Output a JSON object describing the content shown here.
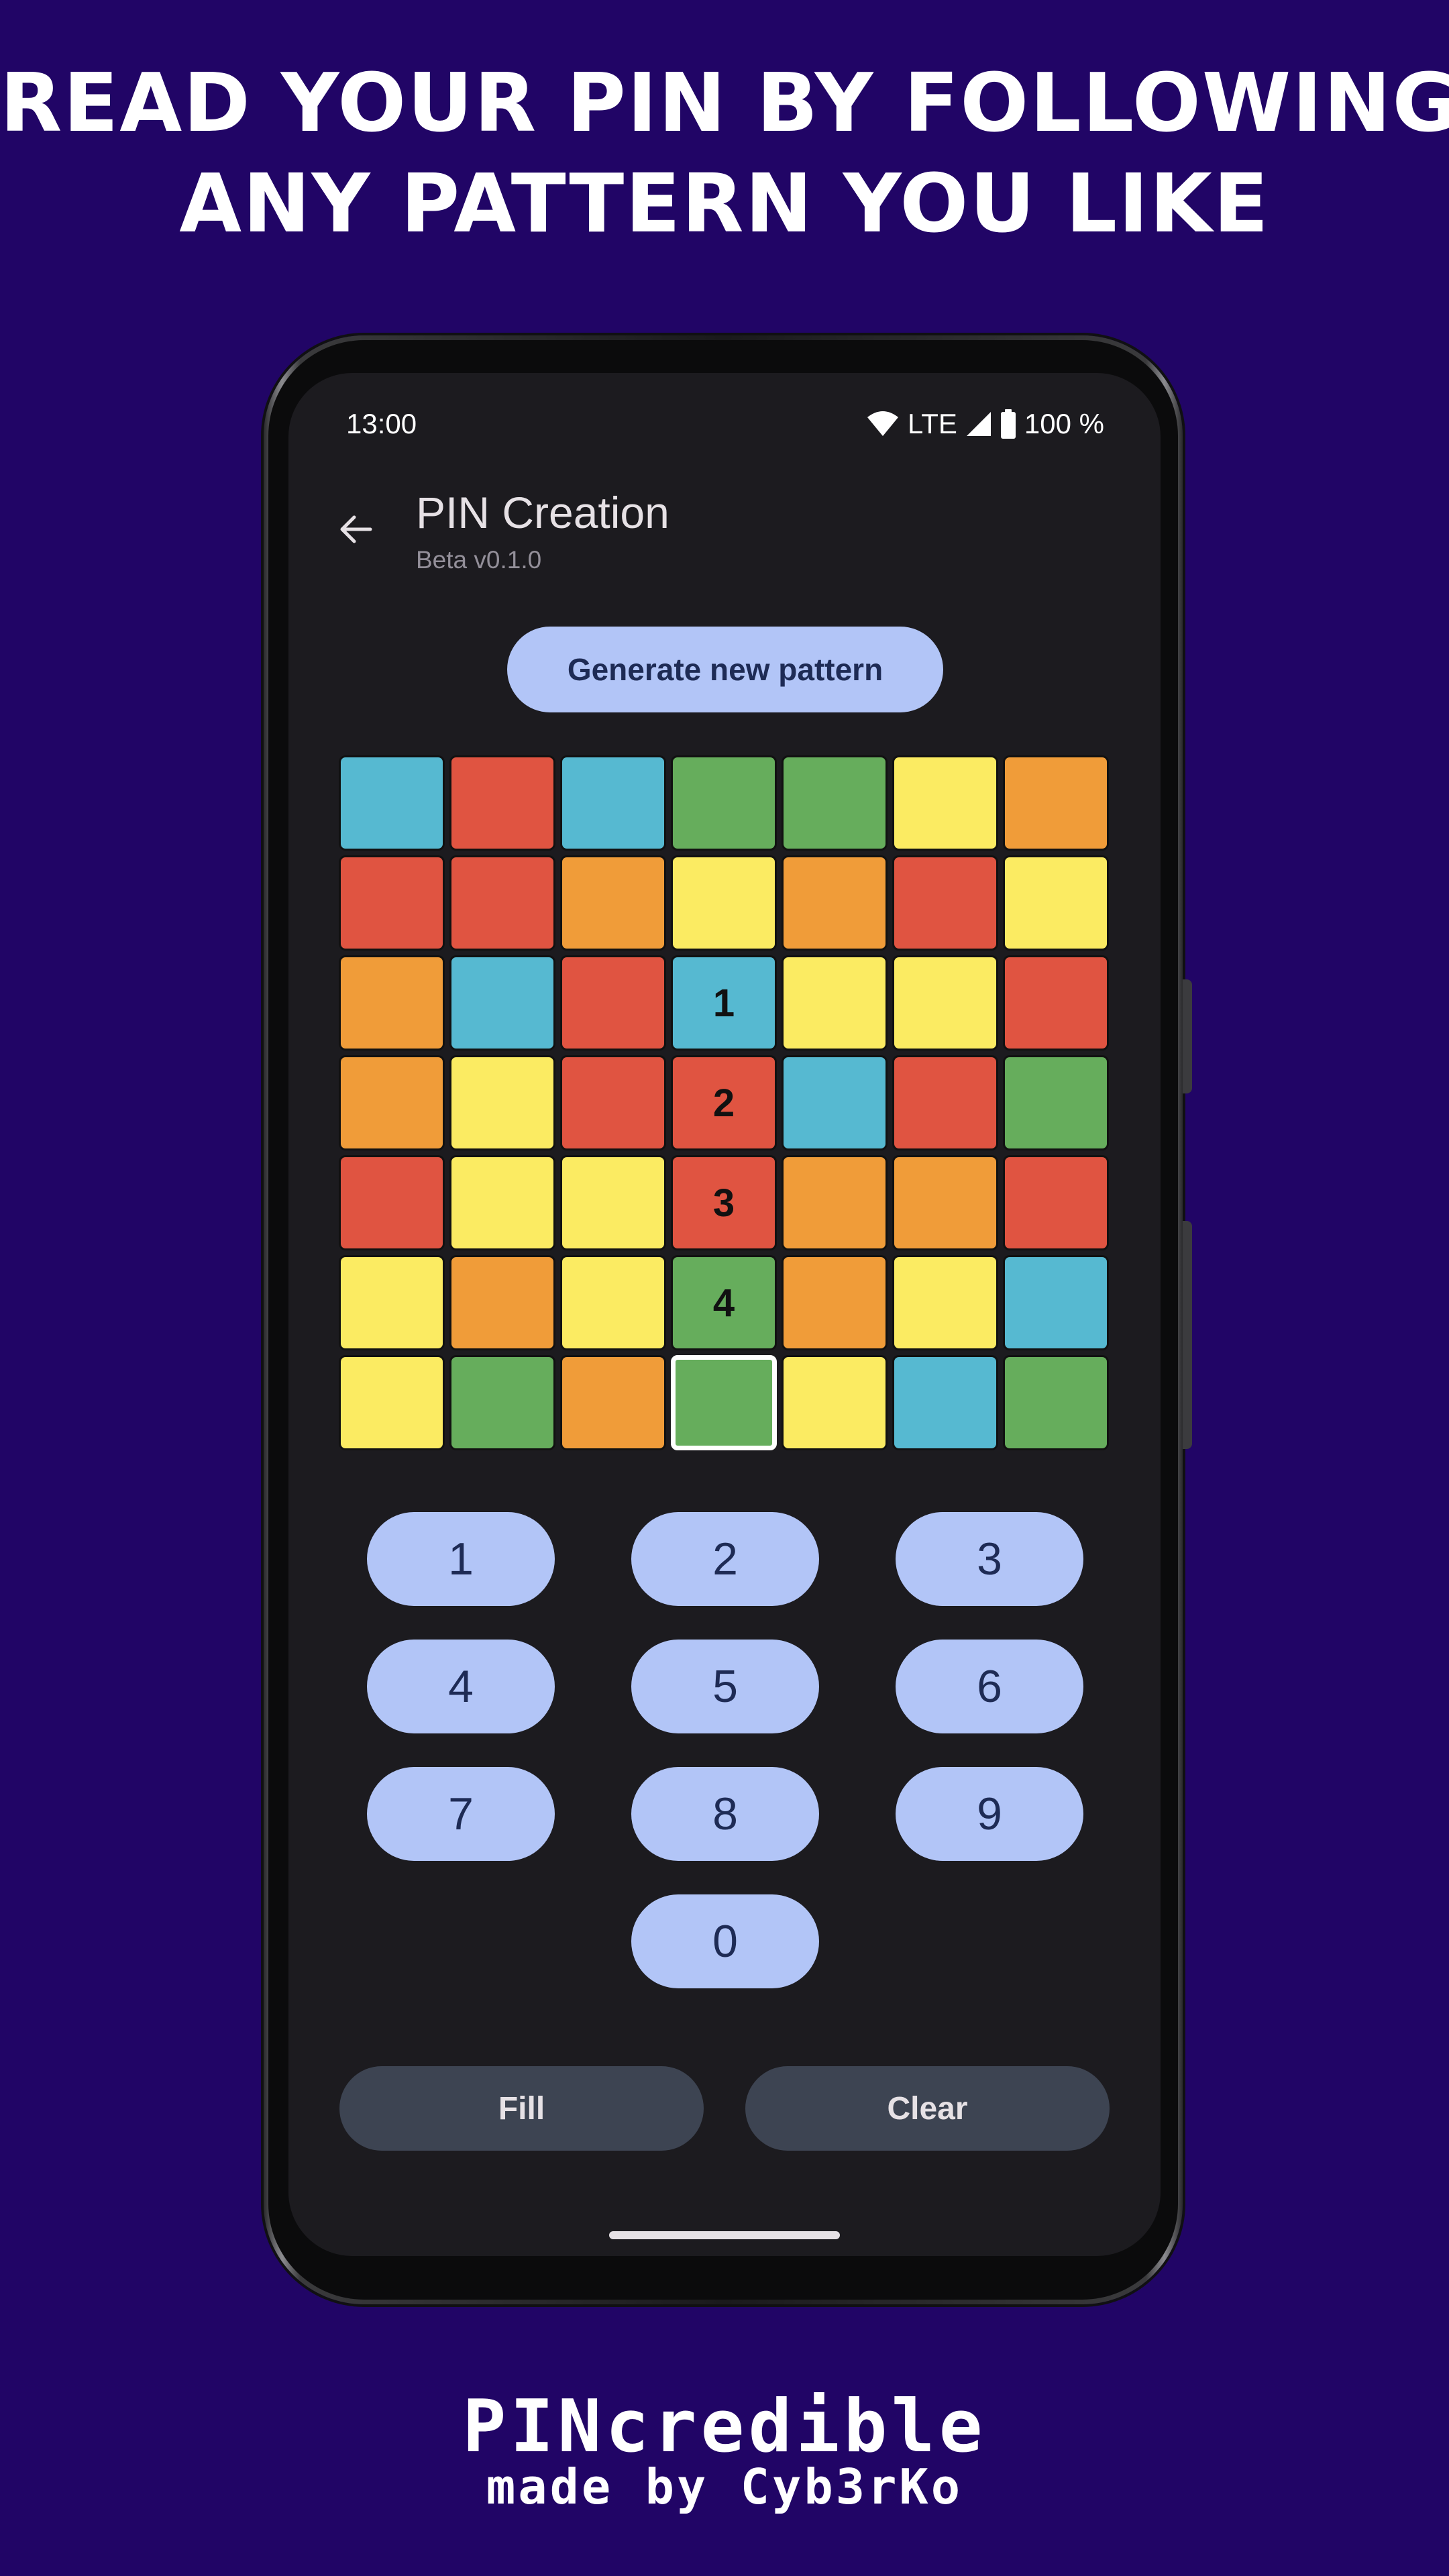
{
  "promo": {
    "headline_line1": "READ YOUR PIN BY FOLLOWING",
    "headline_line2": "ANY PATTERN YOU LIKE",
    "brand_name": "PINcredible",
    "brand_credit": "made by Cyb3rKo"
  },
  "status_bar": {
    "time": "13:00",
    "network": "LTE",
    "battery": "100 %",
    "icons": [
      "wifi-icon",
      "cellular-signal-icon",
      "battery-icon"
    ]
  },
  "app_bar": {
    "title": "PIN Creation",
    "subtitle": "Beta v0.1.0",
    "back_icon": "arrow-back-icon"
  },
  "generate_button": {
    "label": "Generate new pattern"
  },
  "grid": {
    "colors": {
      "blue": "#56b9d1",
      "red": "#e05441",
      "green": "#66ad5c",
      "yellow": "#fbeb62",
      "orange": "#f09c39"
    },
    "rows": [
      [
        "blue",
        "red",
        "blue",
        "green",
        "green",
        "yellow",
        "orange"
      ],
      [
        "red",
        "red",
        "orange",
        "yellow",
        "orange",
        "red",
        "yellow"
      ],
      [
        "orange",
        "blue",
        "red",
        "blue",
        "yellow",
        "yellow",
        "red"
      ],
      [
        "orange",
        "yellow",
        "red",
        "red",
        "blue",
        "red",
        "green"
      ],
      [
        "red",
        "yellow",
        "yellow",
        "red",
        "orange",
        "orange",
        "red"
      ],
      [
        "yellow",
        "orange",
        "yellow",
        "green",
        "orange",
        "yellow",
        "blue"
      ],
      [
        "yellow",
        "green",
        "orange",
        "green",
        "yellow",
        "blue",
        "green"
      ]
    ],
    "numbers": [
      [
        "",
        "",
        "",
        "",
        "",
        "",
        ""
      ],
      [
        "",
        "",
        "",
        "",
        "",
        "",
        ""
      ],
      [
        "",
        "",
        "",
        "1",
        "",
        "",
        ""
      ],
      [
        "",
        "",
        "",
        "2",
        "",
        "",
        ""
      ],
      [
        "",
        "",
        "",
        "3",
        "",
        "",
        ""
      ],
      [
        "",
        "",
        "",
        "4",
        "",
        "",
        ""
      ],
      [
        "",
        "",
        "",
        "",
        "",
        "",
        ""
      ]
    ],
    "selected": {
      "row": 6,
      "col": 3
    }
  },
  "keypad": {
    "keys": [
      "1",
      "2",
      "3",
      "4",
      "5",
      "6",
      "7",
      "8",
      "9",
      "0"
    ]
  },
  "actions": {
    "fill_label": "Fill",
    "clear_label": "Clear"
  },
  "theme": {
    "page_background": "#210566",
    "screen_background": "#1c1b1f",
    "button_primary": "#b2c5f7",
    "button_secondary": "#3d4452"
  }
}
